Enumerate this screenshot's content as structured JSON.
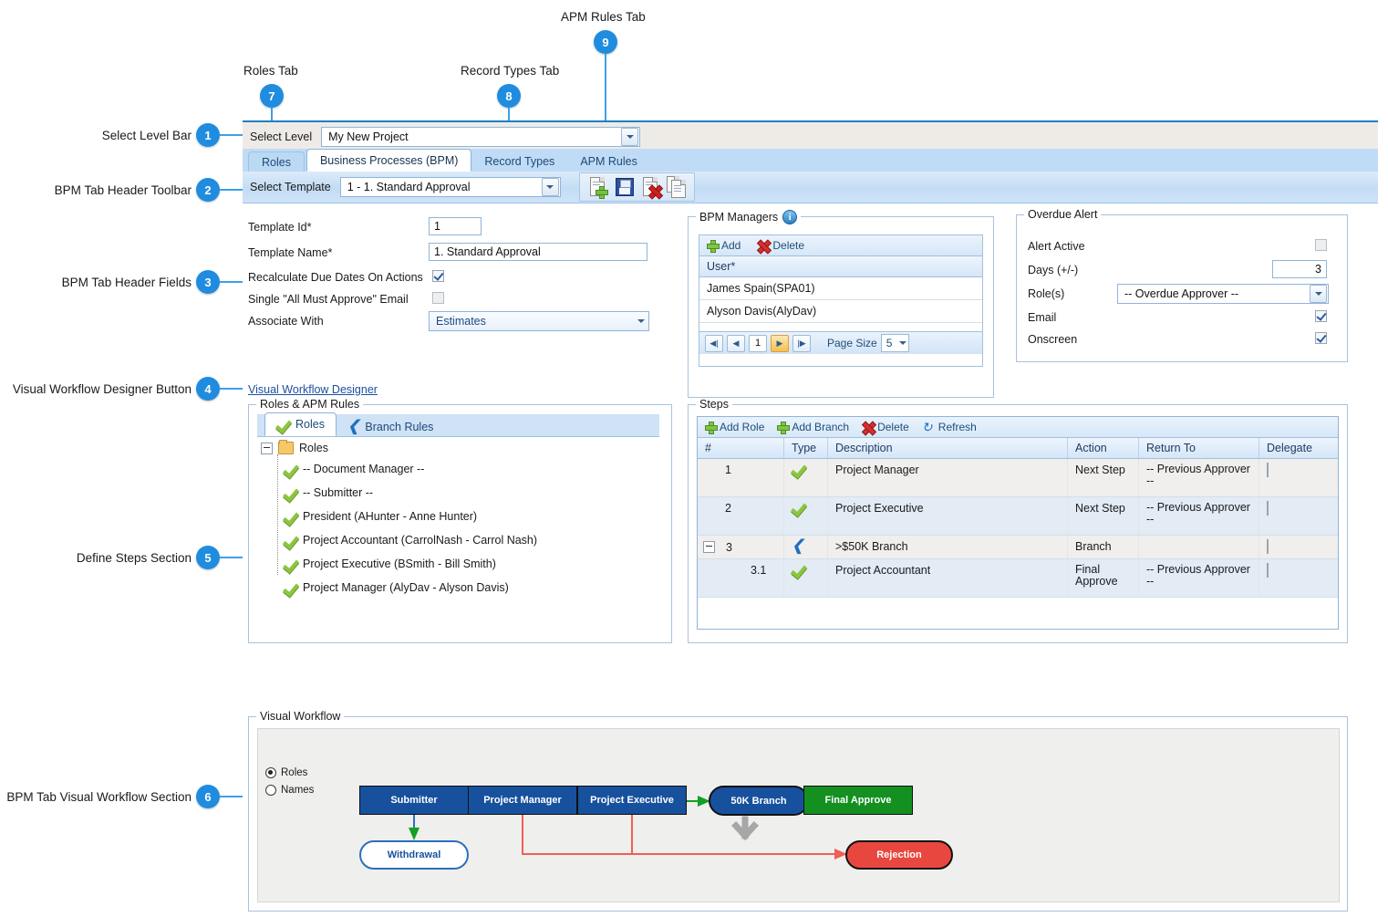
{
  "callouts": [
    {
      "n": "1",
      "label": "Select Level Bar"
    },
    {
      "n": "2",
      "label": "BPM Tab Header Toolbar"
    },
    {
      "n": "3",
      "label": "BPM Tab Header Fields"
    },
    {
      "n": "4",
      "label": "Visual Workflow Designer Button"
    },
    {
      "n": "5",
      "label": "Define Steps Section"
    },
    {
      "n": "6",
      "label": "BPM Tab Visual Workflow Section"
    },
    {
      "n": "7",
      "label": "Roles Tab"
    },
    {
      "n": "8",
      "label": "Record Types Tab"
    },
    {
      "n": "9",
      "label": "APM Rules Tab"
    }
  ],
  "select_level": {
    "label": "Select Level",
    "value": "My New Project"
  },
  "tabs": [
    {
      "label": "Roles",
      "active": false
    },
    {
      "label": "Business Processes (BPM)",
      "active": true
    },
    {
      "label": "Record Types",
      "active": false
    },
    {
      "label": "APM Rules",
      "active": false
    }
  ],
  "template_toolbar": {
    "label": "Select Template",
    "value": "1 - 1. Standard Approval",
    "icons": [
      "new-document-icon",
      "save-icon",
      "delete-document-icon",
      "copy-icon"
    ]
  },
  "header_fields": {
    "template_id": {
      "label": "Template Id*",
      "value": "1"
    },
    "template_name": {
      "label": "Template Name*",
      "value": "1. Standard Approval"
    },
    "recalculate": {
      "label": "Recalculate Due Dates On Actions",
      "checked": true
    },
    "single_email": {
      "label": "Single \"All Must Approve\" Email",
      "checked": false
    },
    "associate_with": {
      "label": "Associate With",
      "value": "Estimates"
    }
  },
  "bpm_managers": {
    "legend": "BPM Managers",
    "info_icon": "i",
    "toolbar": [
      {
        "label": "Add",
        "icon": "plus-icon"
      },
      {
        "label": "Delete",
        "icon": "x-icon"
      }
    ],
    "column": "User*",
    "rows": [
      "James Spain(SPA01)",
      "Alyson Davis(AlyDav)"
    ],
    "pager": {
      "first": "|◀",
      "prev": "◀",
      "page": "1",
      "next": "▶",
      "last": "▶|",
      "page_size_label": "Page Size",
      "page_size_value": "5"
    }
  },
  "overdue_alert": {
    "legend": "Overdue Alert",
    "alert_active": {
      "label": "Alert Active",
      "checked": false
    },
    "days": {
      "label": "Days (+/-)",
      "value": "3"
    },
    "roles": {
      "label": "Role(s)",
      "value": "-- Overdue Approver --"
    },
    "email": {
      "label": "Email",
      "checked": true
    },
    "onscreen": {
      "label": "Onscreen",
      "checked": true
    }
  },
  "vwd_link": "Visual Workflow Designer",
  "roles_panel": {
    "legend": "Roles & APM Rules",
    "tabs": [
      {
        "label": "Roles",
        "icon": "check-icon",
        "active": true
      },
      {
        "label": "Branch Rules",
        "icon": "branch-icon",
        "active": false
      }
    ],
    "root": "Roles",
    "items": [
      "-- Document Manager --",
      "-- Submitter --",
      "President (AHunter - Anne Hunter)",
      "Project Accountant (CarrolNash - Carrol Nash)",
      "Project Executive (BSmith - Bill Smith)",
      "Project Manager (AlyDav - Alyson Davis)"
    ]
  },
  "steps_panel": {
    "legend": "Steps",
    "toolbar": [
      {
        "label": "Add Role",
        "icon": "plus-icon"
      },
      {
        "label": "Add Branch",
        "icon": "plus-icon"
      },
      {
        "label": "Delete",
        "icon": "x-icon"
      },
      {
        "label": "Refresh",
        "icon": "refresh-icon"
      }
    ],
    "columns": [
      "#",
      "Type",
      "Description",
      "Action",
      "Return To",
      "Delegate"
    ],
    "rows": [
      {
        "num": "1",
        "indent": 0,
        "expander": false,
        "type": "check-icon",
        "description": "Project Manager",
        "action": "Next Step",
        "return_to": "-- Previous Approver --",
        "delegate": false
      },
      {
        "num": "2",
        "indent": 0,
        "expander": false,
        "type": "check-icon",
        "description": "Project Executive",
        "action": "Next Step",
        "return_to": "-- Previous Approver --",
        "delegate": false
      },
      {
        "num": "3",
        "indent": 0,
        "expander": true,
        "type": "branch-icon",
        "description": ">$50K Branch",
        "action": "Branch",
        "return_to": "",
        "delegate": false
      },
      {
        "num": "3.1",
        "indent": 1,
        "expander": false,
        "type": "check-icon",
        "description": "Project Accountant",
        "action": "Final Approve",
        "return_to": "-- Previous Approver --",
        "delegate": false
      }
    ]
  },
  "visual_workflow": {
    "legend": "Visual Workflow",
    "options": [
      {
        "label": "Roles",
        "selected": true
      },
      {
        "label": "Names",
        "selected": false
      }
    ],
    "nodes": [
      {
        "label": "Submitter",
        "shape": "rect",
        "color": "#17519e"
      },
      {
        "label": "Withdrawal",
        "shape": "pill-white",
        "color": "#ffffff"
      },
      {
        "label": "Project Manager",
        "shape": "rect",
        "color": "#17519e"
      },
      {
        "label": "Project Executive",
        "shape": "rect",
        "color": "#17519e"
      },
      {
        "label": "50K Branch",
        "shape": "pill-blue",
        "color": "#17519e"
      },
      {
        "label": "Final Approve",
        "shape": "green",
        "color": "#139020"
      },
      {
        "label": "Rejection",
        "shape": "red",
        "color": "#e8473f"
      }
    ]
  }
}
